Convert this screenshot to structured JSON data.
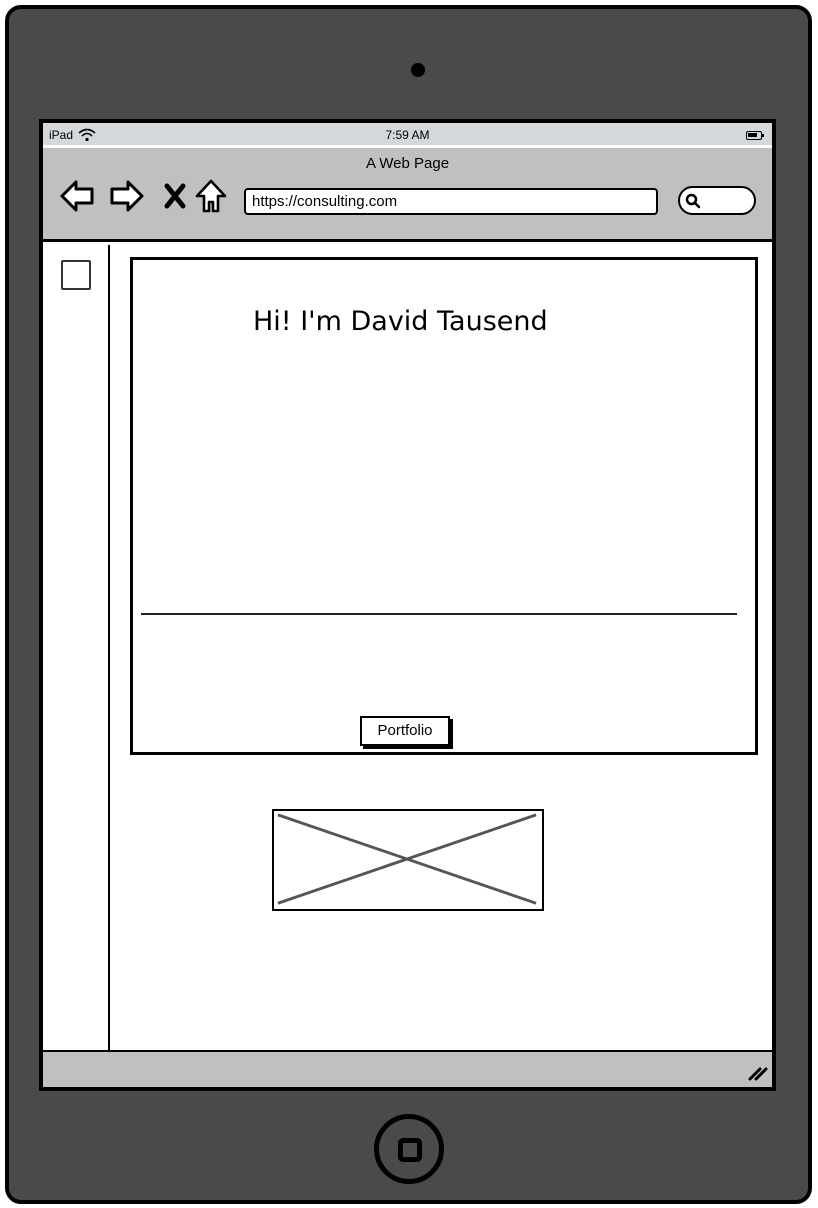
{
  "device": {
    "name": "iPad"
  },
  "statusbar": {
    "carrier": "iPad",
    "time": "7:59 AM",
    "wifi_icon": "wifi-icon",
    "battery_icon": "battery-icon"
  },
  "browser": {
    "title": "A Web Page",
    "url": "https://consulting.com",
    "nav_icons": [
      "back-arrow-icon",
      "forward-arrow-icon",
      "close-icon",
      "home-icon"
    ],
    "search_icon": "search-icon"
  },
  "page": {
    "hero_title": "Hi! I'm David Tausend",
    "portfolio_button_label": "Portfolio"
  },
  "colors": {
    "device_body": "#4a4a4a",
    "browser_bar": "#c0c0c0",
    "status_bar": "#d3d8dc"
  }
}
